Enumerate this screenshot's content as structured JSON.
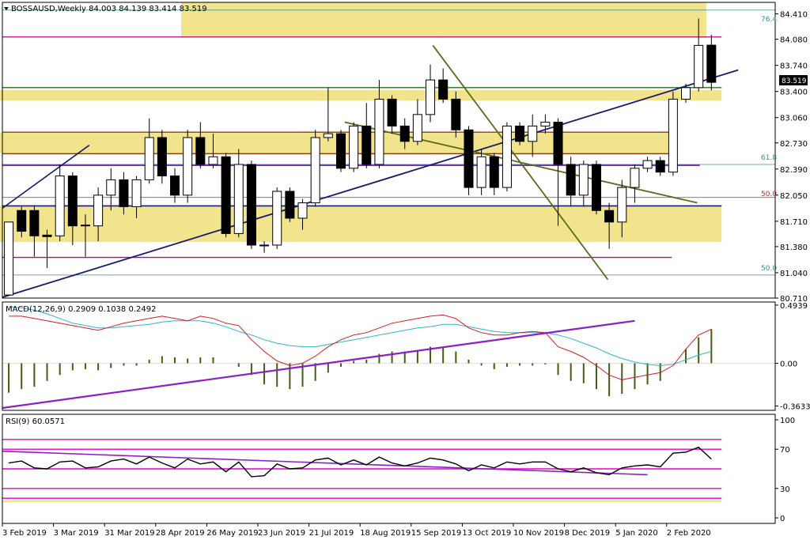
{
  "colors": {
    "background": "#ffffff",
    "up": "#ffffff",
    "down": "#000000",
    "wick": "#000000",
    "zone": "#f2e48c",
    "magenta": "#c0008c",
    "green": "#1a7a1a",
    "brown": "#8b3a14",
    "navy": "#1a1a6e",
    "olive": "#5a6a1e",
    "violet": "#8c1ec8",
    "cyan": "#31b3d2",
    "red": "#d21e1e",
    "teal": "#3a8a8a",
    "hist": "#4a5a10",
    "rsiline": "#000000",
    "rsiband": "#e600c8"
  },
  "header": {
    "title": "BOSSAUSD,Weekly  84.003 84.139 83.414 83.519"
  },
  "price_tag": "83.519",
  "fib_labels": [
    "76.4",
    "61.8",
    "50.0",
    "50.0"
  ],
  "chart_data": [
    {
      "type": "candlestick",
      "title": "BOSSAUSD,Weekly",
      "ohlc_readout": [
        84.003,
        84.139,
        83.414,
        83.519
      ],
      "last_price": 83.519,
      "ylim": [
        80.71,
        84.56
      ],
      "yticks": [
        "84.410",
        "84.080",
        "83.740",
        "83.400",
        "83.060",
        "82.730",
        "82.390",
        "82.050",
        "81.710",
        "81.380",
        "81.040",
        "80.710"
      ],
      "xticks": [
        "3 Feb 2019",
        "3 Mar 2019",
        "31 Mar 2019",
        "28 Apr 2019",
        "26 May 2019",
        "23 Jun 2019",
        "21 Jul 2019",
        "18 Aug 2019",
        "15 Sep 2019",
        "13 Oct 2019",
        "10 Nov 2019",
        "8 Dec 2019",
        "5 Jan 2020",
        "2 Feb 2020"
      ],
      "candles": [
        [
          80.75,
          81.7,
          80.72,
          81.75
        ],
        [
          81.85,
          81.58,
          81.9,
          81.5
        ],
        [
          81.85,
          81.52,
          81.92,
          81.25
        ],
        [
          81.53,
          81.51,
          81.6,
          81.1
        ],
        [
          81.52,
          82.3,
          82.45,
          81.45
        ],
        [
          82.3,
          81.65,
          82.35,
          81.4
        ],
        [
          81.65,
          81.66,
          81.8,
          81.25
        ],
        [
          81.65,
          82.05,
          82.15,
          81.45
        ],
        [
          82.05,
          82.25,
          82.4,
          81.85
        ],
        [
          82.25,
          81.9,
          82.35,
          81.8
        ],
        [
          81.9,
          82.25,
          82.3,
          81.75
        ],
        [
          82.25,
          82.8,
          83.05,
          82.2
        ],
        [
          82.8,
          82.3,
          82.9,
          82.2
        ],
        [
          82.3,
          82.05,
          82.4,
          81.95
        ],
        [
          82.05,
          82.8,
          82.9,
          81.95
        ],
        [
          82.8,
          82.45,
          83.0,
          82.4
        ],
        [
          82.45,
          82.55,
          82.85,
          82.4
        ],
        [
          82.55,
          81.55,
          82.6,
          81.5
        ],
        [
          81.55,
          82.45,
          82.65,
          81.5
        ],
        [
          82.45,
          81.4,
          82.5,
          81.35
        ],
        [
          81.4,
          81.4,
          81.45,
          81.3
        ],
        [
          81.4,
          82.1,
          82.15,
          81.35
        ],
        [
          82.1,
          81.75,
          82.15,
          81.7
        ],
        [
          81.75,
          81.95,
          82.0,
          81.6
        ],
        [
          81.95,
          82.8,
          82.9,
          81.9
        ],
        [
          82.8,
          82.85,
          83.45,
          82.75
        ],
        [
          82.85,
          82.4,
          82.9,
          82.35
        ],
        [
          82.4,
          82.95,
          83.0,
          82.35
        ],
        [
          82.95,
          82.45,
          83.25,
          82.4
        ],
        [
          82.45,
          83.3,
          83.55,
          82.4
        ],
        [
          83.3,
          82.95,
          83.35,
          82.85
        ],
        [
          82.95,
          82.75,
          83.05,
          82.65
        ],
        [
          82.75,
          83.1,
          83.3,
          82.7
        ],
        [
          83.1,
          83.55,
          83.75,
          83.0
        ],
        [
          83.55,
          83.3,
          83.7,
          83.25
        ],
        [
          83.3,
          82.9,
          83.4,
          82.8
        ],
        [
          82.9,
          82.15,
          82.95,
          82.05
        ],
        [
          82.15,
          82.55,
          82.65,
          82.05
        ],
        [
          82.55,
          82.15,
          82.6,
          82.05
        ],
        [
          82.15,
          82.95,
          83.0,
          82.1
        ],
        [
          82.95,
          82.75,
          83.0,
          82.7
        ],
        [
          82.75,
          82.95,
          83.1,
          82.55
        ],
        [
          82.95,
          83.0,
          83.1,
          82.85
        ],
        [
          83.0,
          82.45,
          83.05,
          81.65
        ],
        [
          82.45,
          82.05,
          82.55,
          81.9
        ],
        [
          82.05,
          82.45,
          82.5,
          81.9
        ],
        [
          82.45,
          81.85,
          82.5,
          81.8
        ],
        [
          81.85,
          81.7,
          81.95,
          81.35
        ],
        [
          81.7,
          82.15,
          82.25,
          81.5
        ],
        [
          82.15,
          82.4,
          82.45,
          81.95
        ],
        [
          82.4,
          82.5,
          82.55,
          82.35
        ],
        [
          82.5,
          82.35,
          82.55,
          82.3
        ],
        [
          82.35,
          83.3,
          83.4,
          82.3
        ],
        [
          83.3,
          83.45,
          83.5,
          83.25
        ],
        [
          83.45,
          84.0,
          84.35,
          83.4
        ],
        [
          84.003,
          83.519,
          84.139,
          83.414
        ]
      ]
    },
    {
      "type": "line",
      "title": "MACD(12,26,9) 0.2909 0.1038 0.2492",
      "ylim": [
        -0.4,
        0.52
      ],
      "yticks": [
        "0.4939",
        "0.00",
        "-0.3633"
      ],
      "macd_hist": [
        -0.25,
        -0.22,
        -0.2,
        -0.15,
        -0.1,
        -0.06,
        -0.05,
        -0.06,
        -0.04,
        -0.02,
        -0.02,
        0.03,
        0.06,
        0.05,
        0.04,
        0.05,
        0.05,
        0.0,
        -0.03,
        -0.1,
        -0.18,
        -0.2,
        -0.22,
        -0.2,
        -0.15,
        -0.08,
        -0.03,
        0.02,
        0.03,
        0.08,
        0.1,
        0.1,
        0.11,
        0.14,
        0.13,
        0.1,
        0.03,
        -0.02,
        -0.05,
        -0.03,
        -0.02,
        -0.02,
        -0.01,
        -0.1,
        -0.15,
        -0.17,
        -0.22,
        -0.28,
        -0.26,
        -0.22,
        -0.18,
        -0.15,
        0.0,
        0.12,
        0.22,
        0.29
      ],
      "signal": [
        0.48,
        0.47,
        0.45,
        0.42,
        0.38,
        0.34,
        0.32,
        0.3,
        0.3,
        0.31,
        0.32,
        0.33,
        0.35,
        0.36,
        0.36,
        0.36,
        0.34,
        0.31,
        0.27,
        0.24,
        0.2,
        0.17,
        0.15,
        0.14,
        0.14,
        0.16,
        0.18,
        0.2,
        0.22,
        0.24,
        0.26,
        0.28,
        0.3,
        0.31,
        0.33,
        0.33,
        0.31,
        0.29,
        0.27,
        0.26,
        0.26,
        0.26,
        0.26,
        0.24,
        0.21,
        0.17,
        0.13,
        0.08,
        0.04,
        0.01,
        -0.01,
        -0.02,
        -0.01,
        0.03,
        0.07,
        0.1
      ],
      "macd": [
        0.4,
        0.4,
        0.38,
        0.36,
        0.34,
        0.32,
        0.3,
        0.28,
        0.31,
        0.34,
        0.36,
        0.38,
        0.4,
        0.38,
        0.36,
        0.4,
        0.38,
        0.34,
        0.32,
        0.2,
        0.1,
        0.02,
        -0.02,
        0.0,
        0.06,
        0.14,
        0.2,
        0.24,
        0.26,
        0.3,
        0.34,
        0.36,
        0.38,
        0.4,
        0.41,
        0.38,
        0.3,
        0.26,
        0.24,
        0.24,
        0.26,
        0.27,
        0.26,
        0.14,
        0.1,
        0.05,
        -0.02,
        -0.1,
        -0.14,
        -0.12,
        -0.1,
        -0.08,
        -0.02,
        0.12,
        0.24,
        0.29
      ]
    },
    {
      "type": "line",
      "title": "RSI(9) 60.0571",
      "ylim": [
        0,
        100
      ],
      "yticks": [
        "100",
        "70",
        "30",
        "0"
      ],
      "levels": [
        80,
        70,
        50,
        30,
        20
      ],
      "values": [
        56,
        58,
        51,
        50,
        57,
        58,
        51,
        52,
        58,
        60,
        55,
        62,
        56,
        51,
        60,
        55,
        57,
        47,
        57,
        42,
        43,
        55,
        50,
        51,
        59,
        61,
        54,
        59,
        54,
        62,
        56,
        53,
        56,
        61,
        59,
        55,
        48,
        54,
        51,
        57,
        55,
        57,
        57,
        50,
        47,
        51,
        46,
        44,
        51,
        53,
        54,
        52,
        66,
        67,
        72,
        60
      ]
    }
  ]
}
